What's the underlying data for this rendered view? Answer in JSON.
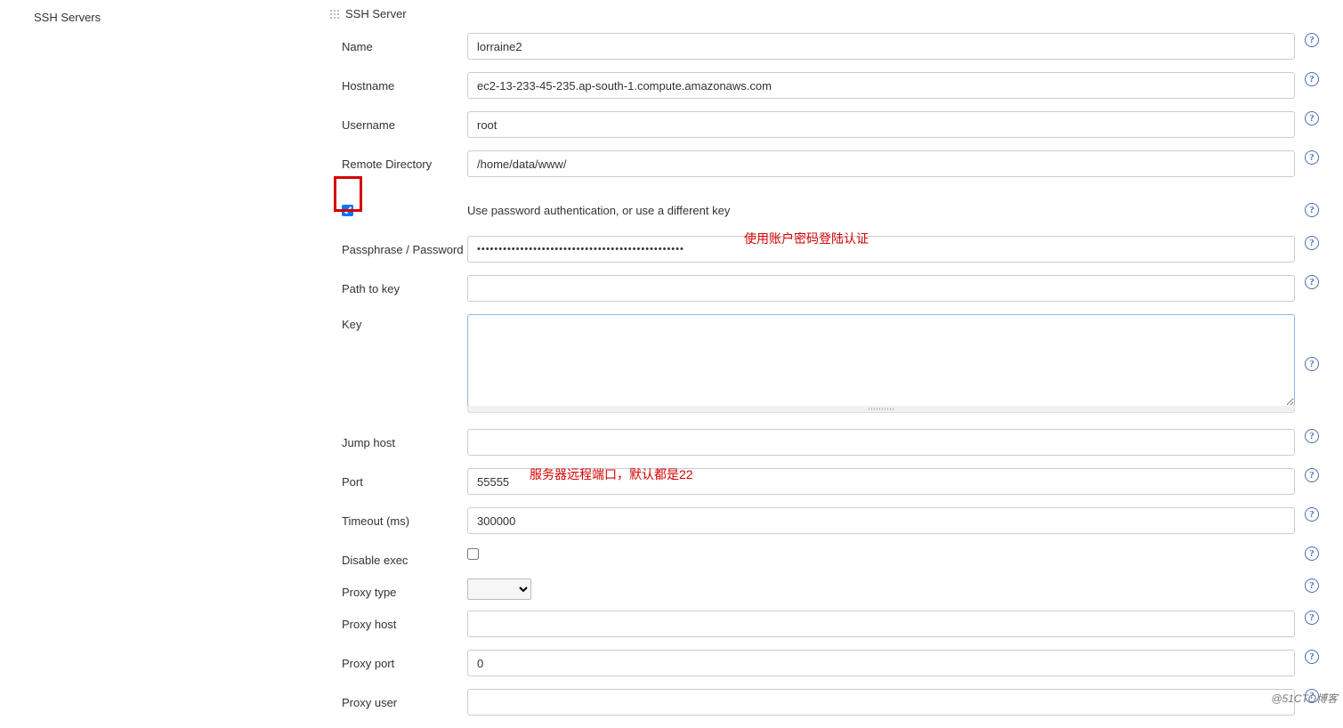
{
  "left": {
    "section_title": "SSH Servers"
  },
  "header": {
    "title": "SSH Server"
  },
  "labels": {
    "name": "Name",
    "hostname": "Hostname",
    "username": "Username",
    "remote_dir": "Remote Directory",
    "use_password": "Use password authentication, or use a different key",
    "passphrase": "Passphrase / Password",
    "path_to_key": "Path to key",
    "key": "Key",
    "jump_host": "Jump host",
    "port": "Port",
    "timeout": "Timeout (ms)",
    "disable_exec": "Disable exec",
    "proxy_type": "Proxy type",
    "proxy_host": "Proxy host",
    "proxy_port": "Proxy port",
    "proxy_user": "Proxy user"
  },
  "values": {
    "name": "lorraine2",
    "hostname": "ec2-13-233-45-235.ap-south-1.compute.amazonaws.com",
    "username": "root",
    "remote_dir": "/home/data/www/",
    "use_password_checked": true,
    "passphrase": "",
    "path_to_key": "",
    "key": "",
    "jump_host": "",
    "port": "55555",
    "timeout": "300000",
    "disable_exec_checked": false,
    "proxy_type": "",
    "proxy_host": "",
    "proxy_port": "0",
    "proxy_user": ""
  },
  "annotations": {
    "password_note": "使用账户密码登陆认证",
    "port_note": "服务器远程端口，默认都是22"
  },
  "watermark": "@51CTO博客",
  "help_glyph": "?"
}
